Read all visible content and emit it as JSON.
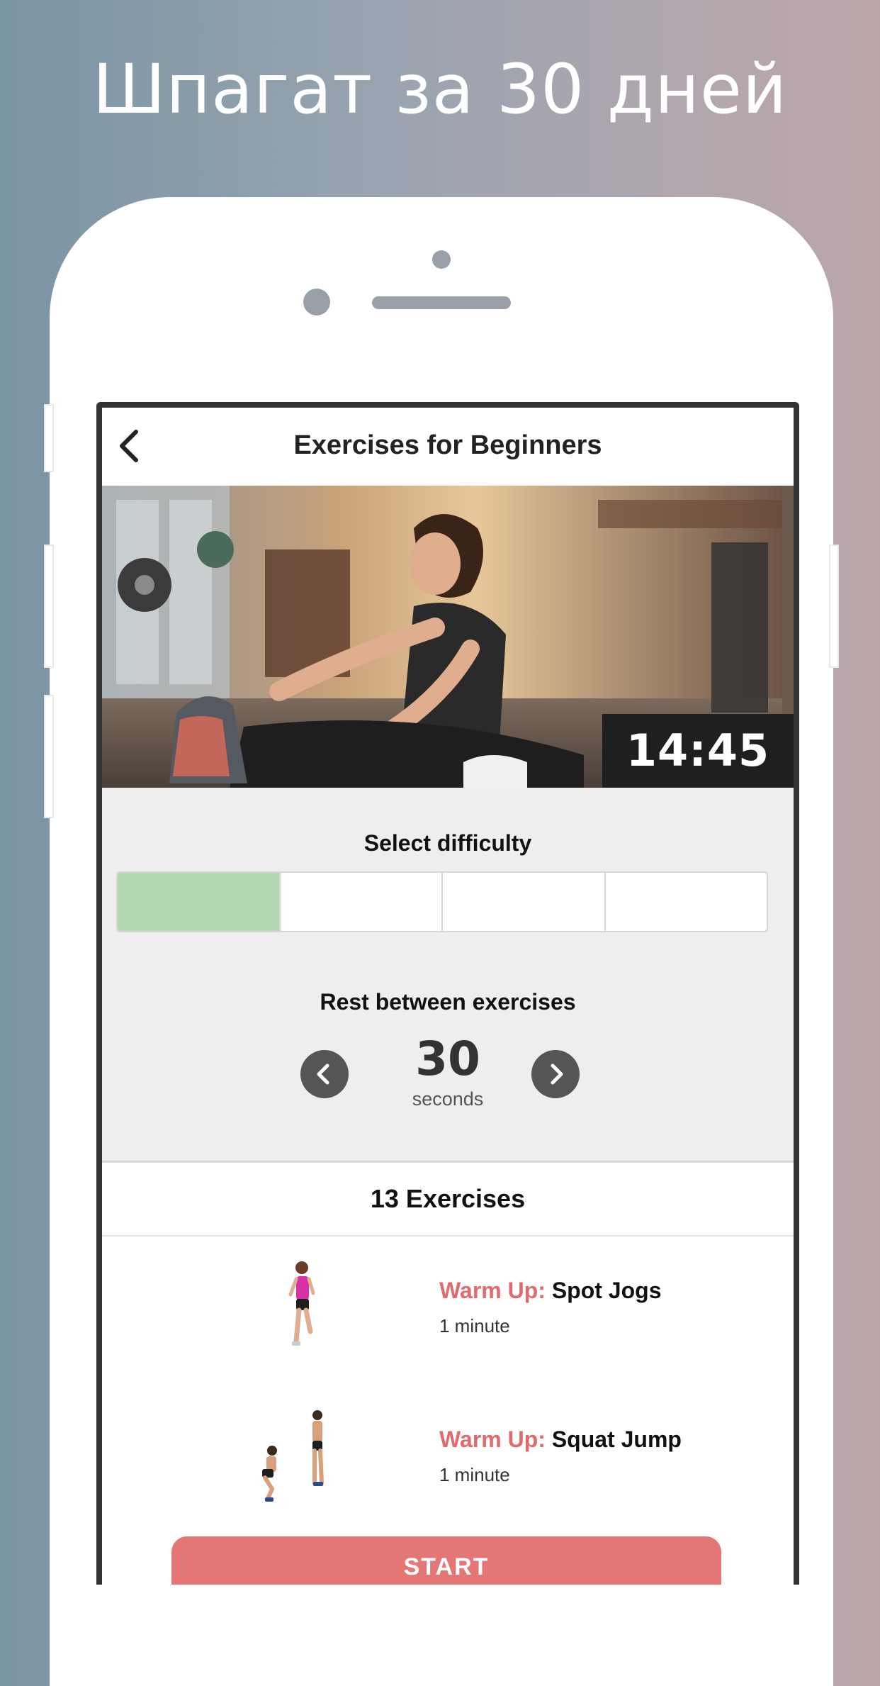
{
  "headline": "Шпагат за 30 дней",
  "screen": {
    "title": "Exercises for Beginners",
    "hero_timer": "14:45",
    "difficulty": {
      "label": "Select difficulty",
      "levels": 4,
      "selected": 1
    },
    "rest": {
      "label": "Rest between exercises",
      "value": "30",
      "unit": "seconds"
    },
    "exercise_count": "13 Exercises",
    "exercises": [
      {
        "tag": "Warm Up:",
        "name": "Spot Jogs",
        "duration": "1 minute"
      },
      {
        "tag": "Warm Up:",
        "name": "Squat Jump",
        "duration": "1 minute"
      }
    ],
    "start_label": "START"
  },
  "colors": {
    "accent": "#e06a6c",
    "start_button": "#e47676",
    "difficulty_active": "#b2d8b0",
    "timer_bg": "#1f1f1f"
  }
}
